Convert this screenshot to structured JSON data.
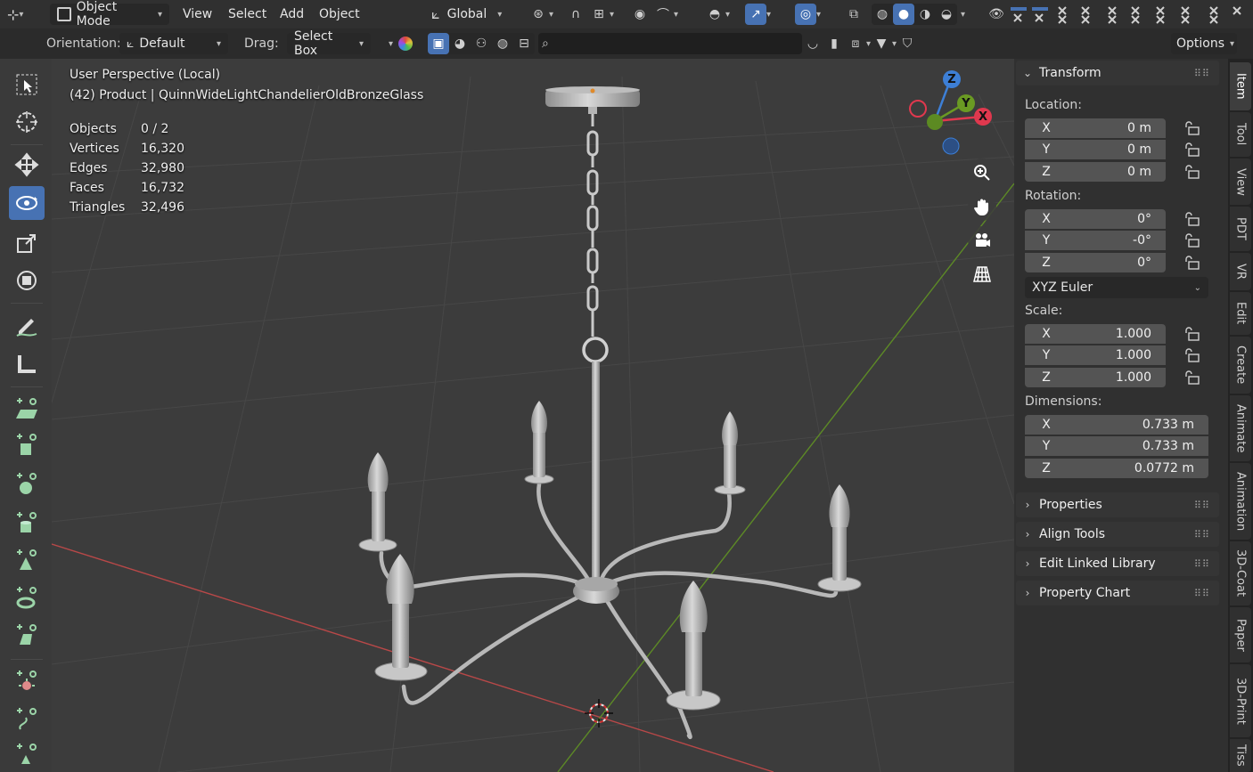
{
  "header": {
    "mode": "Object Mode",
    "menus": [
      "View",
      "Select",
      "Add",
      "Object"
    ],
    "transform_orientation": "Global",
    "orientation_label": "Orientation:",
    "orientation_value": "Default",
    "drag_label": "Drag:",
    "drag_value": "Select Box",
    "options_label": "Options"
  },
  "viewport": {
    "view_name": "User Perspective (Local)",
    "object_line": "(42) Product | QuinnWideLightChandelierOldBronzeGlass",
    "stats": [
      {
        "label": "Objects",
        "value": "0 / 2"
      },
      {
        "label": "Vertices",
        "value": "16,320"
      },
      {
        "label": "Edges",
        "value": "32,980"
      },
      {
        "label": "Faces",
        "value": "16,732"
      },
      {
        "label": "Triangles",
        "value": "32,496"
      }
    ],
    "gizmo": {
      "x": "X",
      "y": "Y",
      "z": "Z"
    }
  },
  "npanel": {
    "transform_title": "Transform",
    "location_label": "Location:",
    "location": [
      {
        "axis": "X",
        "value": "0 m"
      },
      {
        "axis": "Y",
        "value": "0 m"
      },
      {
        "axis": "Z",
        "value": "0 m"
      }
    ],
    "rotation_label": "Rotation:",
    "rotation": [
      {
        "axis": "X",
        "value": "0°"
      },
      {
        "axis": "Y",
        "value": "-0°"
      },
      {
        "axis": "Z",
        "value": "0°"
      }
    ],
    "rotation_mode": "XYZ Euler",
    "scale_label": "Scale:",
    "scale": [
      {
        "axis": "X",
        "value": "1.000"
      },
      {
        "axis": "Y",
        "value": "1.000"
      },
      {
        "axis": "Z",
        "value": "1.000"
      }
    ],
    "dimensions_label": "Dimensions:",
    "dimensions": [
      {
        "axis": "X",
        "value": "0.733 m"
      },
      {
        "axis": "Y",
        "value": "0.733 m"
      },
      {
        "axis": "Z",
        "value": "0.0772 m"
      }
    ],
    "collapsed_sections": [
      "Properties",
      "Align Tools",
      "Edit Linked Library",
      "Property Chart"
    ]
  },
  "tabs": [
    "Item",
    "Tool",
    "View",
    "PDT",
    "VR",
    "Edit",
    "Create",
    "Animate",
    "Animation",
    "3D-Coat",
    "Paper",
    "3D-Print",
    "Tiss"
  ],
  "colors": {
    "accent": "#4772b3",
    "x_axis": "#e0384e",
    "y_axis": "#6a9a23",
    "z_axis": "#3d7fd6"
  }
}
